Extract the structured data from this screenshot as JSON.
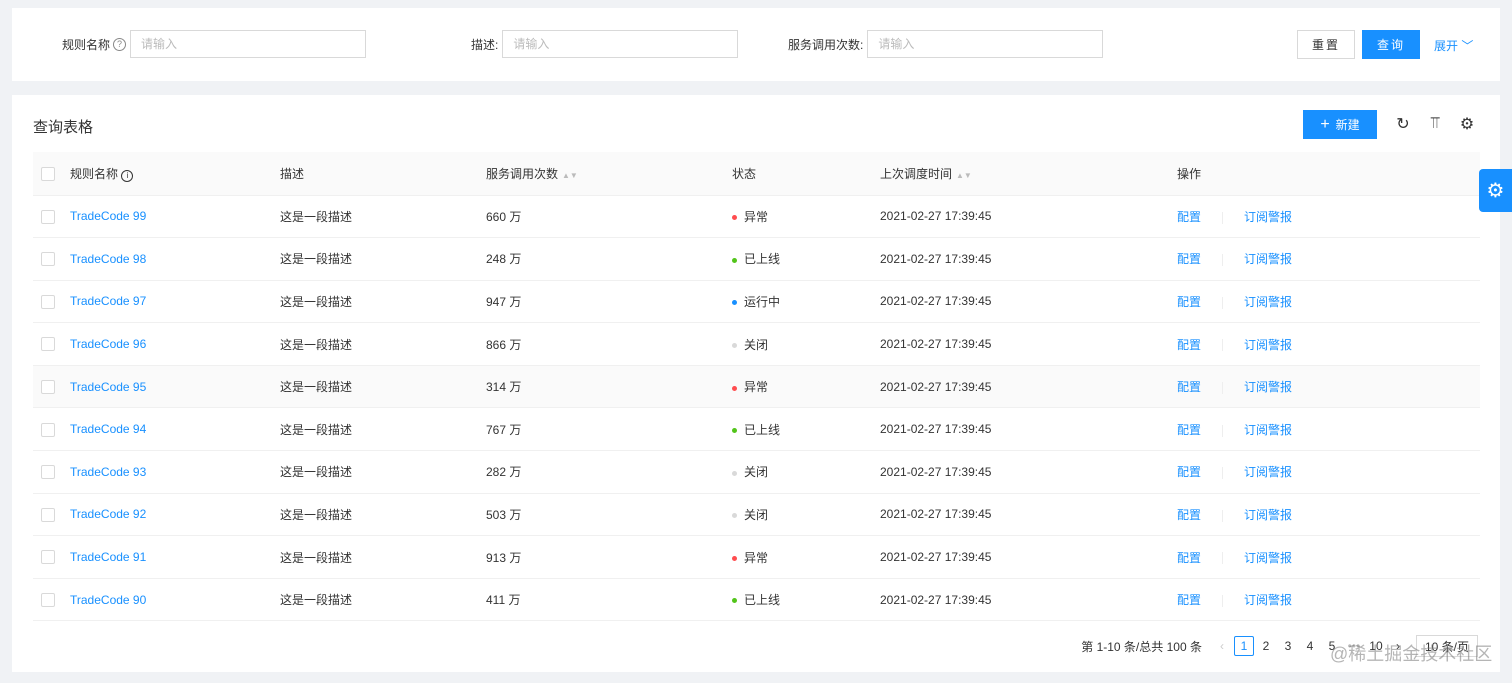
{
  "search": {
    "fields": [
      {
        "label": "规则名称",
        "placeholder": "请输入"
      },
      {
        "label": "描述:",
        "placeholder": "请输入"
      },
      {
        "label": "服务调用次数:",
        "placeholder": "请输入"
      }
    ],
    "reset": "重置",
    "query": "查询",
    "expand": "展开"
  },
  "table": {
    "title": "查询表格",
    "new": "新建",
    "columns": [
      "规则名称",
      "描述",
      "服务调用次数",
      "状态",
      "上次调度时间",
      "操作"
    ],
    "action_config": "配置",
    "action_subscribe": "订阅警报",
    "rows": [
      {
        "name": "TradeCode 99",
        "desc": "这是一段描述",
        "calls": "660 万",
        "status": "异常",
        "color": "#ff4d4f",
        "time": "2021-02-27 17:39:45"
      },
      {
        "name": "TradeCode 98",
        "desc": "这是一段描述",
        "calls": "248 万",
        "status": "已上线",
        "color": "#52c41a",
        "time": "2021-02-27 17:39:45"
      },
      {
        "name": "TradeCode 97",
        "desc": "这是一段描述",
        "calls": "947 万",
        "status": "运行中",
        "color": "#1890ff",
        "time": "2021-02-27 17:39:45"
      },
      {
        "name": "TradeCode 96",
        "desc": "这是一段描述",
        "calls": "866 万",
        "status": "关闭",
        "color": "#d9d9d9",
        "time": "2021-02-27 17:39:45"
      },
      {
        "name": "TradeCode 95",
        "desc": "这是一段描述",
        "calls": "314 万",
        "status": "异常",
        "color": "#ff4d4f",
        "time": "2021-02-27 17:39:45"
      },
      {
        "name": "TradeCode 94",
        "desc": "这是一段描述",
        "calls": "767 万",
        "status": "已上线",
        "color": "#52c41a",
        "time": "2021-02-27 17:39:45"
      },
      {
        "name": "TradeCode 93",
        "desc": "这是一段描述",
        "calls": "282 万",
        "status": "关闭",
        "color": "#d9d9d9",
        "time": "2021-02-27 17:39:45"
      },
      {
        "name": "TradeCode 92",
        "desc": "这是一段描述",
        "calls": "503 万",
        "status": "关闭",
        "color": "#d9d9d9",
        "time": "2021-02-27 17:39:45"
      },
      {
        "name": "TradeCode 91",
        "desc": "这是一段描述",
        "calls": "913 万",
        "status": "异常",
        "color": "#ff4d4f",
        "time": "2021-02-27 17:39:45"
      },
      {
        "name": "TradeCode 90",
        "desc": "这是一段描述",
        "calls": "411 万",
        "status": "已上线",
        "color": "#52c41a",
        "time": "2021-02-27 17:39:45"
      }
    ]
  },
  "pagination": {
    "total": "第 1-10 条/总共 100 条",
    "pages": [
      "1",
      "2",
      "3",
      "4",
      "5",
      "•••",
      "10"
    ],
    "current": "1",
    "page_size": "10 条/页"
  },
  "watermark": "@稀土掘金技术社区"
}
